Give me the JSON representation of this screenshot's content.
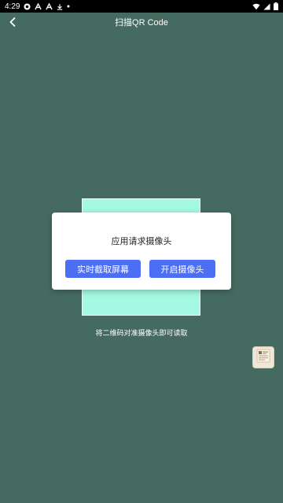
{
  "status_bar": {
    "time": "4:29",
    "icons": [
      "notification-circle-icon",
      "font-a-icon",
      "font-a-icon",
      "download-icon",
      "dot-icon"
    ],
    "right_icons": [
      "wifi-icon",
      "signal-icon",
      "battery-icon"
    ]
  },
  "app_bar": {
    "title": "扫描QR Code",
    "back_icon": "chevron-left-icon"
  },
  "scanner": {
    "hint": "将二维码对准摄像头即可读取",
    "frame_color": "#a3f9e1"
  },
  "dialog": {
    "title": "应用请求摄像头",
    "btn_capture": "实时截取屏幕",
    "btn_camera": "开启摄像头",
    "accent": "#4c6ef5"
  },
  "floating": {
    "icon": "gallery-thumbnail-icon"
  },
  "colors": {
    "background": "#456b61",
    "status_bar": "#000000"
  }
}
